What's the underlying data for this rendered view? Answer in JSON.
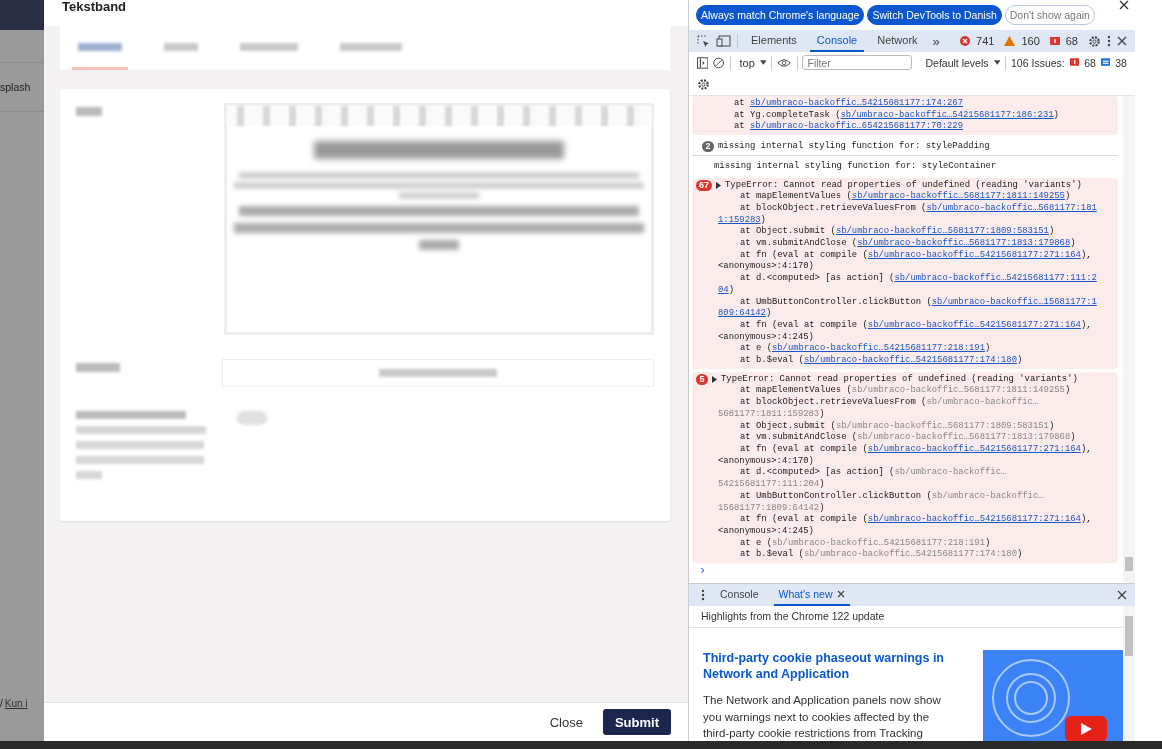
{
  "backdrop": {
    "side_text": "splash",
    "breadcrumb_separator": "/",
    "breadcrumb_link": "Kun i"
  },
  "dialog": {
    "title": "Tekstband",
    "tabs": [
      {
        "selected": true
      },
      {
        "selected": false
      },
      {
        "selected": false
      },
      {
        "selected": false
      }
    ],
    "buttons": {
      "close": "Close",
      "submit": "Submit"
    }
  },
  "devtools": {
    "infobar": {
      "buttons": [
        {
          "label": "Always match Chrome's language",
          "kind": "primary"
        },
        {
          "label": "Switch DevTools to Danish",
          "kind": "primary"
        },
        {
          "label": "Don't show again",
          "kind": "outline"
        }
      ]
    },
    "tabs": [
      {
        "label": "Elements",
        "selected": false
      },
      {
        "label": "Console",
        "selected": true
      },
      {
        "label": "Network",
        "selected": false
      }
    ],
    "more_tabs": "»",
    "counts": {
      "errors": "741",
      "warnings": "160",
      "issues": "68"
    },
    "context": "top",
    "filter": {
      "placeholder": "Filter"
    },
    "levels": "Default levels",
    "issues_label": "106 Issues:",
    "issues_red": "68",
    "issues_blue": "38",
    "messages": [
      {
        "kind": "error",
        "lines": [
          {
            "pre": "at ",
            "link": "sb/umbraco-backoffic…54215681177:174:267",
            "linked": true,
            "wrap": false
          },
          {
            "pre": "at Yg.completeTask (",
            "link": "sb/umbraco-backoffic…54215681177:186:231",
            "post": ")",
            "linked": true,
            "wrap": false
          },
          {
            "pre": "at ",
            "link": "sb/umbraco-backoffic…654215681177:70:229",
            "linked": true,
            "wrap": false
          }
        ]
      },
      {
        "kind": "info",
        "count": "2",
        "text": "missing internal styling function for: stylePadding"
      },
      {
        "kind": "log",
        "text": "missing internal styling function for: styleContainer"
      },
      {
        "kind": "error",
        "count": "67",
        "text": "TypeError: Cannot read properties of undefined (reading 'variants')",
        "lines": [
          {
            "pre": "at mapElementValues (",
            "link": "sb/umbraco-backoffic…5681177:1811:149255",
            "post": ")",
            "linked": true,
            "wrap": false
          },
          {
            "pre": "at blockObject.retrieveValuesFrom (",
            "link": "sb/umbraco-backoffic…5681177:181",
            "linked": true,
            "wrap": false
          },
          {
            "link": "1:159283",
            "post": ")",
            "linked": true,
            "wrap": true
          },
          {
            "pre": "at Object.submit (",
            "link": "sb/umbraco-backoffic…5681177:1809:583151",
            "post": ")",
            "linked": true,
            "wrap": false
          },
          {
            "pre": "at vm.submitAndClose (",
            "link": "sb/umbraco-backoffic…5681177:1813:179868",
            "post": ")",
            "linked": true,
            "wrap": false
          },
          {
            "pre": "at fn (eval at compile (",
            "link": "sb/umbraco-backoffic…54215681177:271:164",
            "post": "),",
            "linked": true,
            "wrap": false
          },
          {
            "pre": "<anonymous>:4:170)",
            "wrap": true
          },
          {
            "pre": "at d.<computed> [as action] (",
            "link": "sb/umbraco-backoffic…54215681177:111:2",
            "linked": true,
            "wrap": false
          },
          {
            "link": "04",
            "post": ")",
            "linked": true,
            "wrap": true
          },
          {
            "pre": "at UmbButtonController.clickButton (",
            "link": "sb/umbraco-backoffic…15681177:1",
            "linked": true,
            "wrap": false
          },
          {
            "link": "809:64142",
            "post": ")",
            "linked": true,
            "wrap": true
          },
          {
            "pre": "at fn (eval at compile (",
            "link": "sb/umbraco-backoffic…54215681177:271:164",
            "post": "),",
            "linked": true,
            "wrap": false
          },
          {
            "pre": "<anonymous>:4:245)",
            "wrap": true
          },
          {
            "pre": "at e (",
            "link": "sb/umbraco-backoffic…54215681177:218:191",
            "post": ")",
            "linked": true,
            "wrap": false
          },
          {
            "pre": "at b.$eval (",
            "link": "sb/umbraco-backoffic…54215681177:174:180",
            "post": ")",
            "linked": true,
            "wrap": false
          }
        ]
      },
      {
        "kind": "error",
        "count": "5",
        "text": "TypeError: Cannot read properties of undefined (reading 'variants')",
        "lines": [
          {
            "pre": "at mapElementValues (",
            "link": "sb/umbraco-backoffic…5681177:1811:149255",
            "post": ")",
            "linked": false,
            "wrap": false
          },
          {
            "pre": "at blockObject.retrieveValuesFrom (",
            "link": "sb/umbraco-backoffic…",
            "linked": false,
            "wrap": false
          },
          {
            "link": "5681177:1811:159283",
            "post": ")",
            "linked": false,
            "wrap": true
          },
          {
            "pre": "at Object.submit (",
            "link": "sb/umbraco-backoffic…5681177:1809:583151",
            "post": ")",
            "linked": false,
            "wrap": false
          },
          {
            "pre": "at vm.submitAndClose (",
            "link": "sb/umbraco-backoffic…5681177:1813:179868",
            "post": ")",
            "linked": false,
            "wrap": false
          },
          {
            "pre": "at fn (eval at compile (",
            "link": "sb/umbraco-backoffic…54215681177:271:164",
            "post": "),",
            "linked": true,
            "wrap": false
          },
          {
            "pre": "<anonymous>:4:170)",
            "wrap": true
          },
          {
            "pre": "at d.<computed> [as action] (",
            "link": "sb/umbraco-backoffic…",
            "linked": false,
            "wrap": false
          },
          {
            "link": "54215681177:111:204",
            "post": ")",
            "linked": false,
            "wrap": true
          },
          {
            "pre": "at UmbButtonController.clickButton (",
            "link": "sb/umbraco-backoffic…",
            "linked": false,
            "wrap": false
          },
          {
            "link": "15681177:1809:64142",
            "post": ")",
            "linked": false,
            "wrap": true
          },
          {
            "pre": "at fn (eval at compile (",
            "link": "sb/umbraco-backoffic…54215681177:271:164",
            "post": "),",
            "linked": true,
            "wrap": false
          },
          {
            "pre": "<anonymous>:4:245)",
            "wrap": true
          },
          {
            "pre": "at e (",
            "link": "sb/umbraco-backoffic…54215681177:218:191",
            "post": ")",
            "linked": false,
            "wrap": false
          },
          {
            "pre": "at b.$eval (",
            "link": "sb/umbraco-backoffic…54215681177:174:180",
            "post": ")",
            "linked": false,
            "wrap": false
          }
        ]
      }
    ],
    "prompt": "›",
    "drawer": {
      "tabs": [
        {
          "label": "Console",
          "selected": false,
          "closable": false
        },
        {
          "label": "What's new",
          "selected": true,
          "closable": true
        }
      ],
      "subtitle": "Highlights from the Chrome 122 update",
      "heading": "Third-party cookie phaseout warnings in Network and Application",
      "body": "The Network and Application panels now show you warnings next to cookies affected by the third-party cookie restrictions from Tracking"
    }
  }
}
